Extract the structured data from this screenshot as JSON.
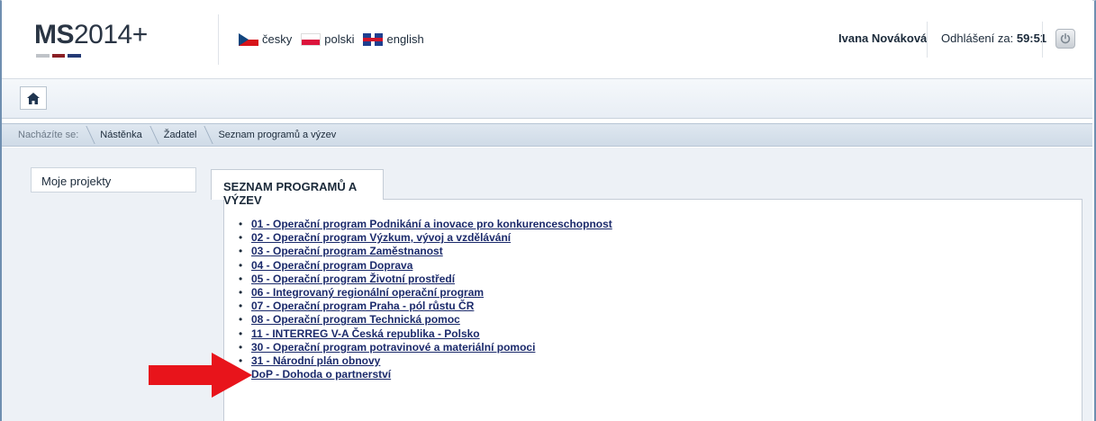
{
  "header": {
    "logo_bold": "MS",
    "logo_rest": "2014+",
    "languages": [
      {
        "label": "česky",
        "flag": "flag-cz-icon"
      },
      {
        "label": "polski",
        "flag": "flag-pl-icon"
      },
      {
        "label": "english",
        "flag": "flag-gb-icon"
      }
    ],
    "user_name": "Ivana Nováková",
    "logout_label": "Odhlášení za:",
    "logout_timer": "59:51"
  },
  "toolbar": {
    "home_icon": "home-icon"
  },
  "breadcrumb": {
    "prefix": "Nacházíte se:",
    "items": [
      "Nástěnka",
      "Žadatel",
      "Seznam programů a výzev"
    ]
  },
  "sidebar": {
    "item": "Moje projekty"
  },
  "main": {
    "tab_label": "SEZNAM PROGRAMŮ A VÝZEV",
    "programs": [
      "01 - Operační program Podnikání a inovace pro konkurenceschopnost",
      "02 - Operační program Výzkum, vývoj a vzdělávání",
      "03 - Operační program Zaměstnanost",
      "04 - Operační program Doprava",
      "05 - Operační program Životní prostředí",
      "06 - Integrovaný regionální operační program",
      "07 - Operační program Praha - pól růstu ČR",
      "08 - Operační program Technická pomoc",
      "11 - INTERREG V-A Česká republika - Polsko",
      "30 - Operační program potravinové a materiální pomoci",
      "31 - Národní plán obnovy",
      "DoP - Dohoda o partnerství"
    ]
  },
  "colors": {
    "arrow": "#e8141b",
    "brand_stripe": [
      "#bfc3c8",
      "#8a1f24",
      "#243a75"
    ]
  }
}
